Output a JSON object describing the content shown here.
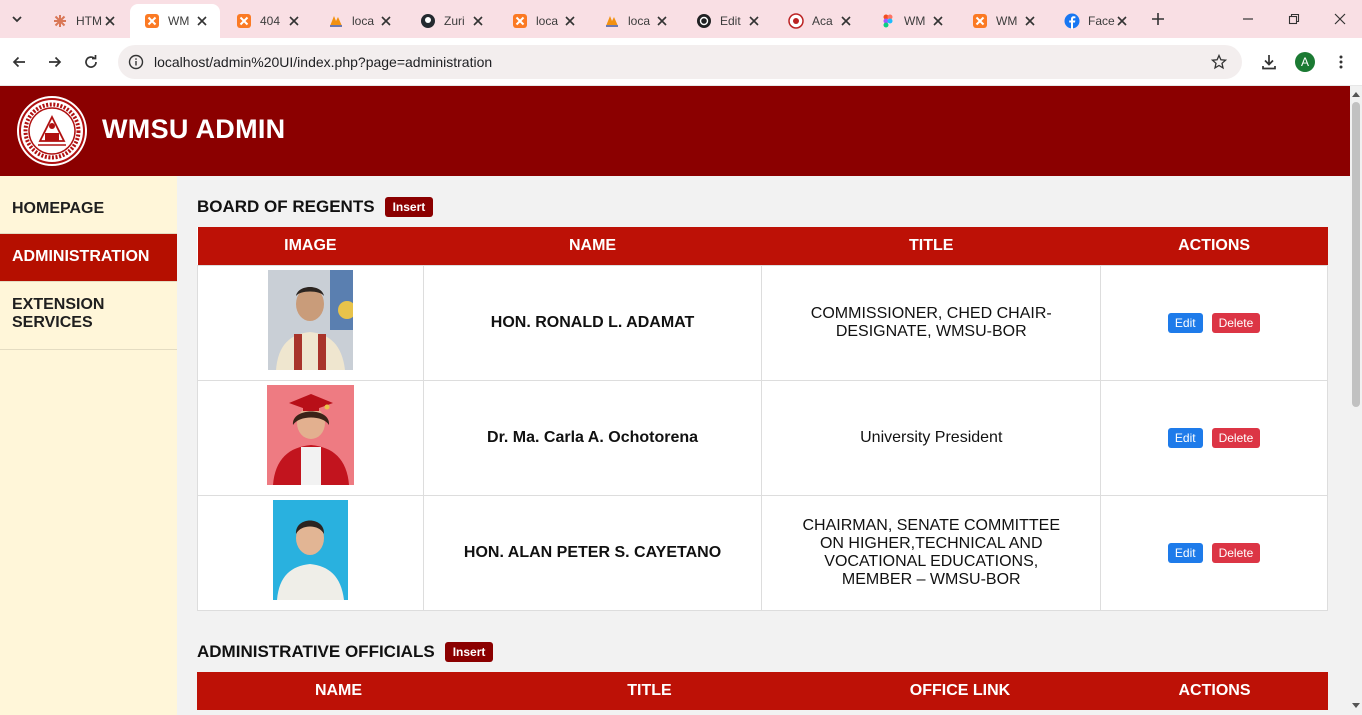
{
  "browser": {
    "tabs": [
      {
        "label": "HTM",
        "icon": "claude-icon"
      },
      {
        "label": "WM",
        "icon": "xampp-icon",
        "active": true
      },
      {
        "label": "404",
        "icon": "xampp-icon"
      },
      {
        "label": "loca",
        "icon": "phpmyadmin-icon"
      },
      {
        "label": "Zuri",
        "icon": "github-icon"
      },
      {
        "label": "loca",
        "icon": "xampp-icon"
      },
      {
        "label": "loca",
        "icon": "phpmyadmin-icon"
      },
      {
        "label": "Edit",
        "icon": "openai-icon"
      },
      {
        "label": "Aca",
        "icon": "seal-icon"
      },
      {
        "label": "WM",
        "icon": "figma-icon"
      },
      {
        "label": "WM",
        "icon": "xampp-icon"
      },
      {
        "label": "Face",
        "icon": "facebook-icon"
      }
    ],
    "url": "localhost/admin%20UI/index.php?page=administration",
    "profile_initial": "A"
  },
  "site": {
    "title": "WMSU ADMIN",
    "brand_color": "#8b0000",
    "header_red": "#bd1106"
  },
  "sidebar": {
    "items": [
      {
        "label": "HOMEPAGE"
      },
      {
        "label": "ADMINISTRATION",
        "active": true
      },
      {
        "label": "EXTENSION SERVICES"
      }
    ]
  },
  "board": {
    "title": "BOARD OF REGENTS",
    "insert_label": "Insert",
    "columns": [
      "IMAGE",
      "NAME",
      "TITLE",
      "ACTIONS"
    ],
    "rows": [
      {
        "name": "HON. RONALD L. ADAMAT",
        "title": "COMMISSIONER, CHED CHAIR-DESIGNATE, WMSU-BOR",
        "edit": "Edit",
        "delete": "Delete"
      },
      {
        "name": "Dr. Ma. Carla A. Ochotorena",
        "title": "University President",
        "edit": "Edit",
        "delete": "Delete"
      },
      {
        "name": "HON. ALAN PETER S. CAYETANO",
        "title": "CHAIRMAN, SENATE COMMITTEE ON HIGHER,TECHNICAL AND VOCATIONAL EDUCATIONS, MEMBER – WMSU-BOR",
        "edit": "Edit",
        "delete": "Delete"
      }
    ]
  },
  "officials": {
    "title": "ADMINISTRATIVE OFFICIALS",
    "insert_label": "Insert",
    "columns": [
      "NAME",
      "TITLE",
      "OFFICE LINK",
      "ACTIONS"
    ]
  }
}
